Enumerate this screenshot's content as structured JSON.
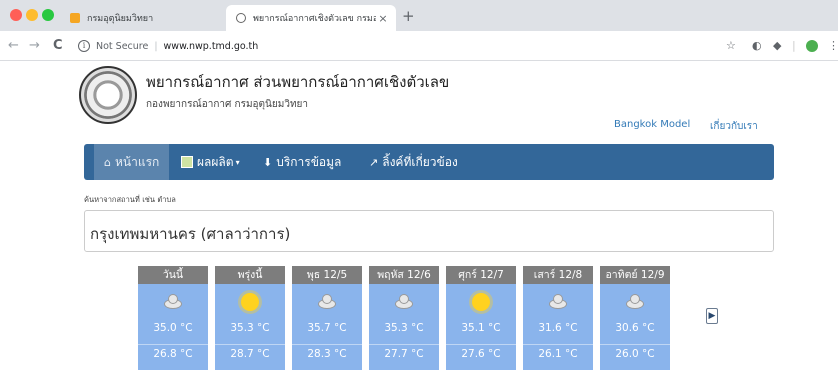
{
  "browser": {
    "tabs": [
      {
        "title": "กรมอุตุนิยมวิทยา",
        "active": false
      },
      {
        "title": "พยากรณ์อากาศเชิงตัวเลข กรมอุตุนิ",
        "active": true
      }
    ],
    "new_tab": "+",
    "close_glyph": "×",
    "security_label": "Not Secure",
    "url": "www.nwp.tmd.go.th",
    "nav_back": "←",
    "nav_forward": "→",
    "nav_reload": "C"
  },
  "site": {
    "title": "พยากรณ์อากาศ ส่วนพยากรณ์อากาศเชิงตัวเลข",
    "subtitle": "กองพยากรณ์อากาศ กรมอุตุนิยมวิทยา",
    "top_links": [
      "Bangkok Model",
      "เกี่ยวกับเรา"
    ]
  },
  "nav": {
    "items": [
      {
        "label": "หน้าแรก",
        "icon": "home-icon"
      },
      {
        "label": "ผลผลิต",
        "icon": "products-icon"
      },
      {
        "label": "บริการข้อมูล",
        "icon": "download-icon"
      },
      {
        "label": "ลิ้งค์ที่เกี่ยวข้อง",
        "icon": "external-link-icon"
      }
    ]
  },
  "search": {
    "label": "ค้นหาจากสถานที่ เช่น ตำบล",
    "value": "กรุงเทพมหานคร (ศาลาว่าการ)"
  },
  "forecast": {
    "days": [
      {
        "label": "วันนี้",
        "icon": "cloud",
        "high": "35.0 °C",
        "low": "26.8 °C"
      },
      {
        "label": "พรุ่งนี้",
        "icon": "sun",
        "high": "35.3 °C",
        "low": "28.7 °C"
      },
      {
        "label": "พุธ 12/5",
        "icon": "cloud",
        "high": "35.7 °C",
        "low": "28.3 °C"
      },
      {
        "label": "พฤหัส 12/6",
        "icon": "cloud",
        "high": "35.3 °C",
        "low": "27.7 °C"
      },
      {
        "label": "ศุกร์ 12/7",
        "icon": "sun",
        "high": "35.1 °C",
        "low": "27.6 °C"
      },
      {
        "label": "เสาร์ 12/8",
        "icon": "cloud",
        "high": "31.6 °C",
        "low": "26.1 °C"
      },
      {
        "label": "อาทิตย์ 12/9",
        "icon": "cloud",
        "high": "30.6 °C",
        "low": "26.0 °C"
      }
    ]
  }
}
